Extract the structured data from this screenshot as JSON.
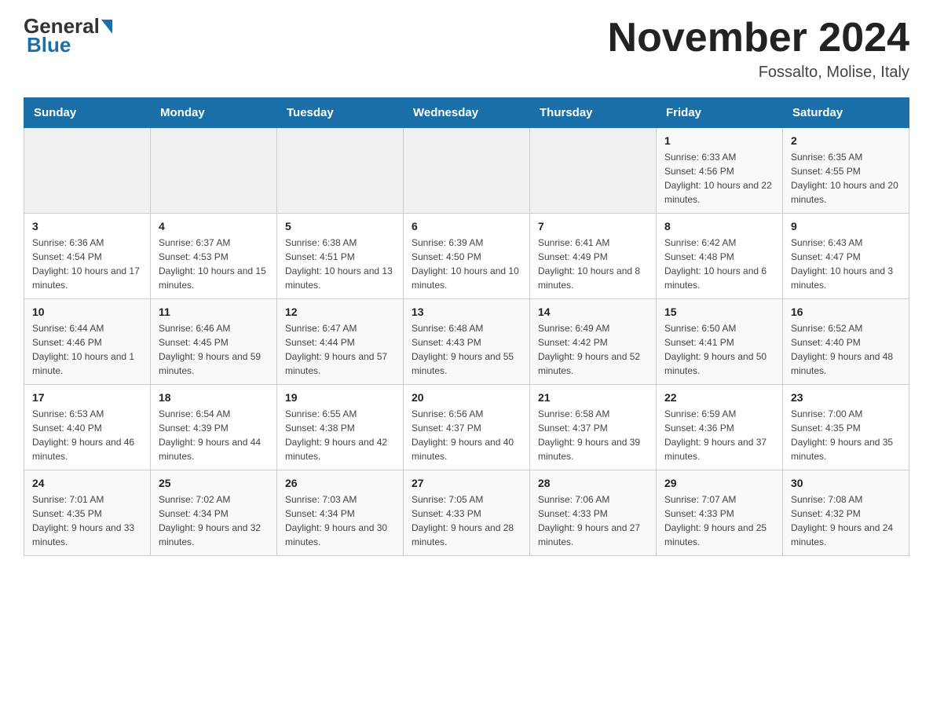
{
  "header": {
    "logo": {
      "general": "General",
      "blue": "Blue"
    },
    "title": "November 2024",
    "location": "Fossalto, Molise, Italy"
  },
  "weekdays": [
    "Sunday",
    "Monday",
    "Tuesday",
    "Wednesday",
    "Thursday",
    "Friday",
    "Saturday"
  ],
  "weeks": [
    [
      {
        "day": "",
        "sunrise": "",
        "sunset": "",
        "daylight": ""
      },
      {
        "day": "",
        "sunrise": "",
        "sunset": "",
        "daylight": ""
      },
      {
        "day": "",
        "sunrise": "",
        "sunset": "",
        "daylight": ""
      },
      {
        "day": "",
        "sunrise": "",
        "sunset": "",
        "daylight": ""
      },
      {
        "day": "",
        "sunrise": "",
        "sunset": "",
        "daylight": ""
      },
      {
        "day": "1",
        "sunrise": "Sunrise: 6:33 AM",
        "sunset": "Sunset: 4:56 PM",
        "daylight": "Daylight: 10 hours and 22 minutes."
      },
      {
        "day": "2",
        "sunrise": "Sunrise: 6:35 AM",
        "sunset": "Sunset: 4:55 PM",
        "daylight": "Daylight: 10 hours and 20 minutes."
      }
    ],
    [
      {
        "day": "3",
        "sunrise": "Sunrise: 6:36 AM",
        "sunset": "Sunset: 4:54 PM",
        "daylight": "Daylight: 10 hours and 17 minutes."
      },
      {
        "day": "4",
        "sunrise": "Sunrise: 6:37 AM",
        "sunset": "Sunset: 4:53 PM",
        "daylight": "Daylight: 10 hours and 15 minutes."
      },
      {
        "day": "5",
        "sunrise": "Sunrise: 6:38 AM",
        "sunset": "Sunset: 4:51 PM",
        "daylight": "Daylight: 10 hours and 13 minutes."
      },
      {
        "day": "6",
        "sunrise": "Sunrise: 6:39 AM",
        "sunset": "Sunset: 4:50 PM",
        "daylight": "Daylight: 10 hours and 10 minutes."
      },
      {
        "day": "7",
        "sunrise": "Sunrise: 6:41 AM",
        "sunset": "Sunset: 4:49 PM",
        "daylight": "Daylight: 10 hours and 8 minutes."
      },
      {
        "day": "8",
        "sunrise": "Sunrise: 6:42 AM",
        "sunset": "Sunset: 4:48 PM",
        "daylight": "Daylight: 10 hours and 6 minutes."
      },
      {
        "day": "9",
        "sunrise": "Sunrise: 6:43 AM",
        "sunset": "Sunset: 4:47 PM",
        "daylight": "Daylight: 10 hours and 3 minutes."
      }
    ],
    [
      {
        "day": "10",
        "sunrise": "Sunrise: 6:44 AM",
        "sunset": "Sunset: 4:46 PM",
        "daylight": "Daylight: 10 hours and 1 minute."
      },
      {
        "day": "11",
        "sunrise": "Sunrise: 6:46 AM",
        "sunset": "Sunset: 4:45 PM",
        "daylight": "Daylight: 9 hours and 59 minutes."
      },
      {
        "day": "12",
        "sunrise": "Sunrise: 6:47 AM",
        "sunset": "Sunset: 4:44 PM",
        "daylight": "Daylight: 9 hours and 57 minutes."
      },
      {
        "day": "13",
        "sunrise": "Sunrise: 6:48 AM",
        "sunset": "Sunset: 4:43 PM",
        "daylight": "Daylight: 9 hours and 55 minutes."
      },
      {
        "day": "14",
        "sunrise": "Sunrise: 6:49 AM",
        "sunset": "Sunset: 4:42 PM",
        "daylight": "Daylight: 9 hours and 52 minutes."
      },
      {
        "day": "15",
        "sunrise": "Sunrise: 6:50 AM",
        "sunset": "Sunset: 4:41 PM",
        "daylight": "Daylight: 9 hours and 50 minutes."
      },
      {
        "day": "16",
        "sunrise": "Sunrise: 6:52 AM",
        "sunset": "Sunset: 4:40 PM",
        "daylight": "Daylight: 9 hours and 48 minutes."
      }
    ],
    [
      {
        "day": "17",
        "sunrise": "Sunrise: 6:53 AM",
        "sunset": "Sunset: 4:40 PM",
        "daylight": "Daylight: 9 hours and 46 minutes."
      },
      {
        "day": "18",
        "sunrise": "Sunrise: 6:54 AM",
        "sunset": "Sunset: 4:39 PM",
        "daylight": "Daylight: 9 hours and 44 minutes."
      },
      {
        "day": "19",
        "sunrise": "Sunrise: 6:55 AM",
        "sunset": "Sunset: 4:38 PM",
        "daylight": "Daylight: 9 hours and 42 minutes."
      },
      {
        "day": "20",
        "sunrise": "Sunrise: 6:56 AM",
        "sunset": "Sunset: 4:37 PM",
        "daylight": "Daylight: 9 hours and 40 minutes."
      },
      {
        "day": "21",
        "sunrise": "Sunrise: 6:58 AM",
        "sunset": "Sunset: 4:37 PM",
        "daylight": "Daylight: 9 hours and 39 minutes."
      },
      {
        "day": "22",
        "sunrise": "Sunrise: 6:59 AM",
        "sunset": "Sunset: 4:36 PM",
        "daylight": "Daylight: 9 hours and 37 minutes."
      },
      {
        "day": "23",
        "sunrise": "Sunrise: 7:00 AM",
        "sunset": "Sunset: 4:35 PM",
        "daylight": "Daylight: 9 hours and 35 minutes."
      }
    ],
    [
      {
        "day": "24",
        "sunrise": "Sunrise: 7:01 AM",
        "sunset": "Sunset: 4:35 PM",
        "daylight": "Daylight: 9 hours and 33 minutes."
      },
      {
        "day": "25",
        "sunrise": "Sunrise: 7:02 AM",
        "sunset": "Sunset: 4:34 PM",
        "daylight": "Daylight: 9 hours and 32 minutes."
      },
      {
        "day": "26",
        "sunrise": "Sunrise: 7:03 AM",
        "sunset": "Sunset: 4:34 PM",
        "daylight": "Daylight: 9 hours and 30 minutes."
      },
      {
        "day": "27",
        "sunrise": "Sunrise: 7:05 AM",
        "sunset": "Sunset: 4:33 PM",
        "daylight": "Daylight: 9 hours and 28 minutes."
      },
      {
        "day": "28",
        "sunrise": "Sunrise: 7:06 AM",
        "sunset": "Sunset: 4:33 PM",
        "daylight": "Daylight: 9 hours and 27 minutes."
      },
      {
        "day": "29",
        "sunrise": "Sunrise: 7:07 AM",
        "sunset": "Sunset: 4:33 PM",
        "daylight": "Daylight: 9 hours and 25 minutes."
      },
      {
        "day": "30",
        "sunrise": "Sunrise: 7:08 AM",
        "sunset": "Sunset: 4:32 PM",
        "daylight": "Daylight: 9 hours and 24 minutes."
      }
    ]
  ]
}
